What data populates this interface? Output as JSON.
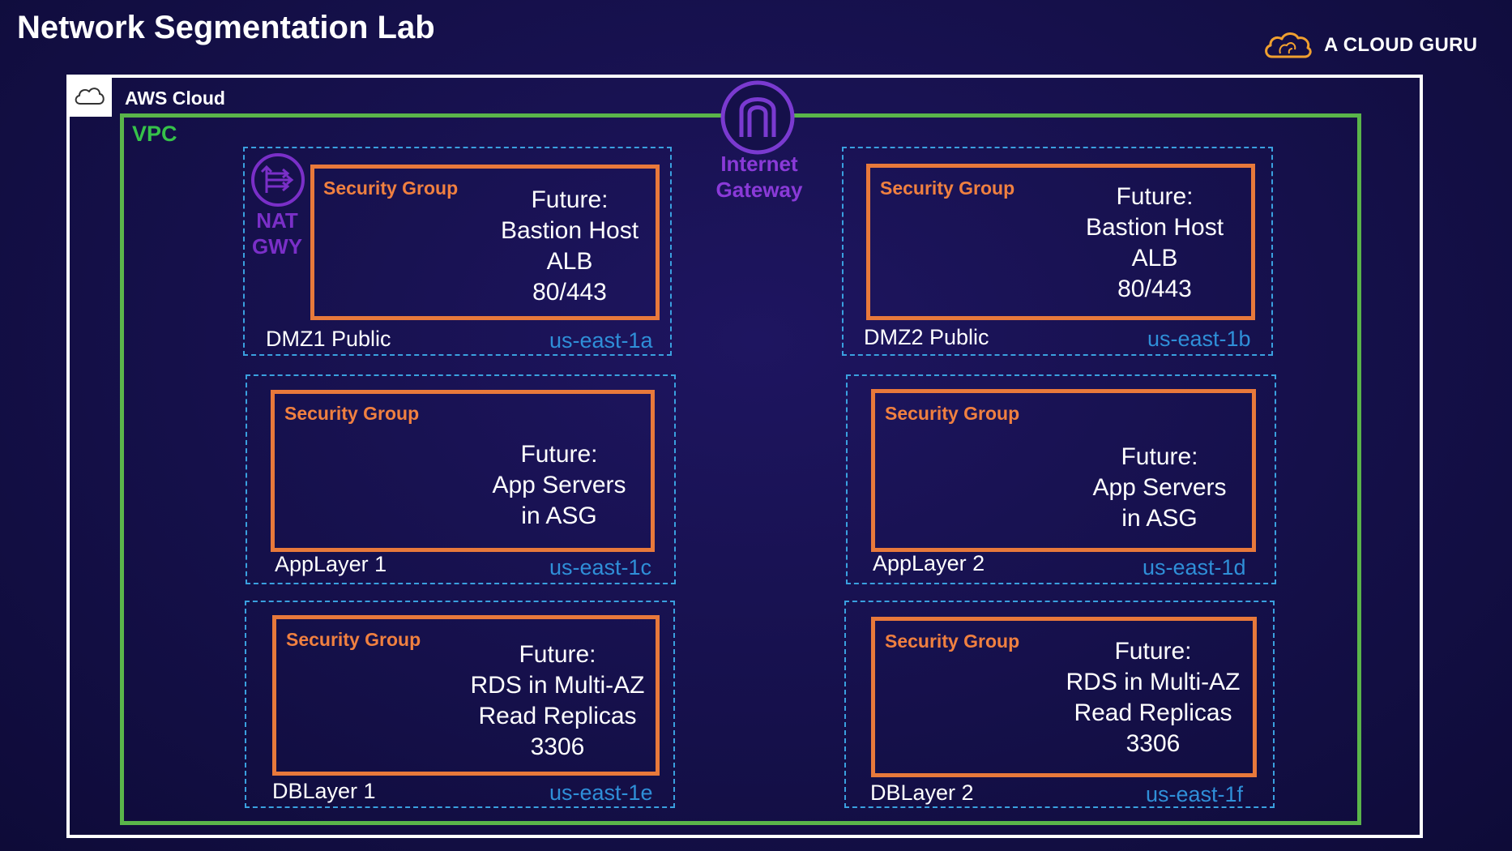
{
  "title": "Network Segmentation Lab",
  "brand": {
    "name": "A CLOUD GURU"
  },
  "aws_cloud": {
    "label": "AWS Cloud"
  },
  "vpc": {
    "label": "VPC"
  },
  "internet_gateway": {
    "line1": "Internet",
    "line2": "Gateway"
  },
  "nat_gateway": {
    "line1": "NAT",
    "line2": "GWY"
  },
  "colors": {
    "background": "#15104a",
    "vpc_border": "#5ab54a",
    "subnet_border": "#3aa0df",
    "security_group": "#e8793b",
    "gateway_purple": "#8a3ad8"
  },
  "subnets": [
    {
      "name": "DMZ1 Public",
      "az": "us-east-1a",
      "sg_label": "Security Group",
      "future": [
        "Future:",
        "Bastion Host",
        "ALB",
        "80/443"
      ]
    },
    {
      "name": "DMZ2 Public",
      "az": "us-east-1b",
      "sg_label": "Security Group",
      "future": [
        "Future:",
        "Bastion Host",
        "ALB",
        "80/443"
      ]
    },
    {
      "name": "AppLayer 1",
      "az": "us-east-1c",
      "sg_label": "Security Group",
      "future": [
        "Future:",
        "App Servers",
        "in ASG"
      ]
    },
    {
      "name": "AppLayer 2",
      "az": "us-east-1d",
      "sg_label": "Security Group",
      "future": [
        "Future:",
        "App Servers",
        "in ASG"
      ]
    },
    {
      "name": "DBLayer 1",
      "az": "us-east-1e",
      "sg_label": "Security Group",
      "future": [
        "Future:",
        "RDS in Multi-AZ",
        "Read Replicas",
        "3306"
      ]
    },
    {
      "name": "DBLayer 2",
      "az": "us-east-1f",
      "sg_label": "Security Group",
      "future": [
        "Future:",
        "RDS in Multi-AZ",
        "Read Replicas",
        "3306"
      ]
    }
  ]
}
